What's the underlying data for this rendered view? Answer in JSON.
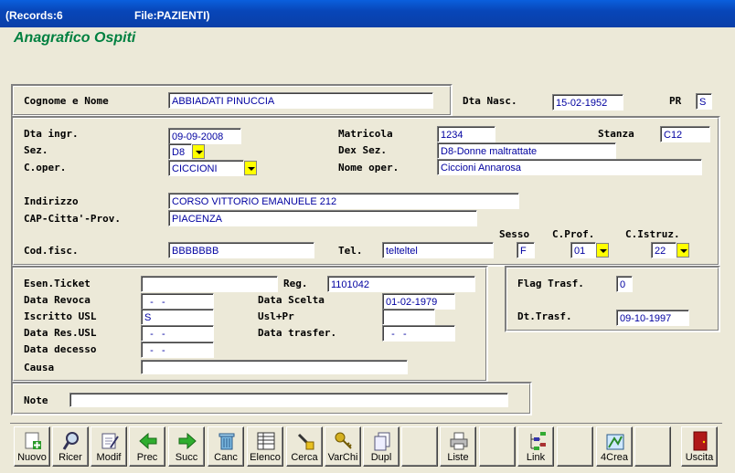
{
  "title": {
    "records": "(Records:6",
    "file": "File:PAZIENTI)"
  },
  "heading": "Anagrafico Ospiti",
  "fields": {
    "cognome_nome": {
      "label": "Cognome e Nome",
      "value": "ABBIADATI PINUCCIA"
    },
    "dta_nasc": {
      "label": "Dta Nasc.",
      "value": "15-02-1952"
    },
    "pr": {
      "label": "PR",
      "value": "S"
    },
    "dta_ingr": {
      "label": "Dta ingr.",
      "value": "09-09-2008"
    },
    "matricola": {
      "label": "Matricola",
      "value": "1234"
    },
    "stanza": {
      "label": "Stanza",
      "value": "C12"
    },
    "sez": {
      "label": "Sez.",
      "value": "D8"
    },
    "dex_sez": {
      "label": "Dex Sez.",
      "value": "D8-Donne maltrattate"
    },
    "c_oper": {
      "label": "C.oper.",
      "value": "CICCIONI"
    },
    "nome_oper": {
      "label": "Nome oper.",
      "value": "Ciccioni Annarosa"
    },
    "indirizzo": {
      "label": "Indirizzo",
      "value": "CORSO VITTORIO EMANUELE 212"
    },
    "cap_citta_prov": {
      "label": "CAP-Citta'-Prov.",
      "value": "PIACENZA"
    },
    "cod_fisc": {
      "label": "Cod.fisc.",
      "value": "BBBBBBB"
    },
    "tel": {
      "label": "Tel.",
      "value": "telteltel"
    },
    "sesso": {
      "label": "Sesso",
      "value": "F"
    },
    "c_prof": {
      "label": "C.Prof.",
      "value": "01"
    },
    "c_istruz": {
      "label": "C.Istruz.",
      "value": "22"
    },
    "esen_ticket": {
      "label": "Esen.Ticket",
      "value": ""
    },
    "reg": {
      "label": "Reg.",
      "value": "1101042"
    },
    "data_revoca": {
      "label": "Data Revoca",
      "value": "  -   -"
    },
    "data_scelta": {
      "label": "Data Scelta",
      "value": "01-02-1979"
    },
    "iscritto_usl": {
      "label": "Iscritto USL",
      "value": "S"
    },
    "usl_pr": {
      "label": "Usl+Pr",
      "value": ""
    },
    "data_res_usl": {
      "label": "Data Res.USL",
      "value": "  -   -"
    },
    "data_trasfer": {
      "label": "Data trasfer.",
      "value": "  -   -"
    },
    "data_decesso": {
      "label": "Data decesso",
      "value": "  -   -"
    },
    "causa": {
      "label": "Causa",
      "value": ""
    },
    "flag_trasf": {
      "label": "Flag Trasf.",
      "value": "0"
    },
    "dt_trasf": {
      "label": "Dt.Trasf.",
      "value": "09-10-1997"
    },
    "note": {
      "label": "Note",
      "value": ""
    }
  },
  "toolbar": [
    {
      "label": "Nuovo",
      "icon": "new-record-icon"
    },
    {
      "label": "Ricer",
      "icon": "search-icon"
    },
    {
      "label": "Modif",
      "icon": "edit-icon"
    },
    {
      "label": "Prec",
      "icon": "arrow-left-icon"
    },
    {
      "label": "Succ",
      "icon": "arrow-right-icon"
    },
    {
      "label": "Canc",
      "icon": "trash-icon"
    },
    {
      "label": "Elenco",
      "icon": "list-icon"
    },
    {
      "label": "Cerca",
      "icon": "find-icon"
    },
    {
      "label": "VarChi",
      "icon": "keys-icon"
    },
    {
      "label": "Dupl",
      "icon": "duplicate-icon"
    },
    {
      "label": "",
      "icon": ""
    },
    {
      "label": "Liste",
      "icon": "printer-icon"
    },
    {
      "label": "",
      "icon": ""
    },
    {
      "label": "Link",
      "icon": "tree-icon"
    },
    {
      "label": "",
      "icon": ""
    },
    {
      "label": "4Crea",
      "icon": "create-icon"
    },
    {
      "label": "",
      "icon": ""
    },
    {
      "label": "Uscita",
      "icon": "exit-door-icon"
    }
  ],
  "colors": {
    "accent_heading": "#008040",
    "field_text": "#0000a0",
    "dropdown": "#ffff00"
  }
}
